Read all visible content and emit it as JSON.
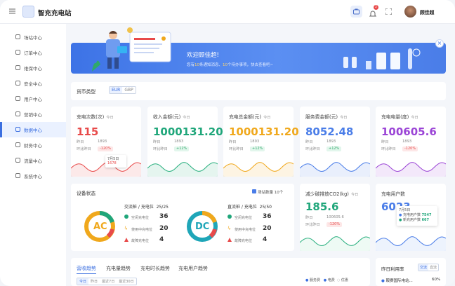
{
  "app": {
    "title": "智充充电站"
  },
  "user": {
    "name": "顾佳超",
    "notif_count": "2"
  },
  "sidebar": {
    "items": [
      {
        "label": "场站中心"
      },
      {
        "label": "订单中心"
      },
      {
        "label": "维保中心"
      },
      {
        "label": "安全中心"
      },
      {
        "label": "用户中心"
      },
      {
        "label": "营销中心"
      },
      {
        "label": "数据中心"
      },
      {
        "label": "财务中心"
      },
      {
        "label": "流量中心"
      },
      {
        "label": "系统中心"
      }
    ],
    "active_index": 6
  },
  "banner": {
    "title": "欢迎顾佳超!",
    "subtitle_pre": "您有",
    "n1": "10",
    "subtitle_mid": "条通知消息、",
    "n2": "10",
    "subtitle_post": "个待办事项，快去查看吧~"
  },
  "currency": {
    "label": "货币类型",
    "options": [
      "EUR",
      "GBP"
    ],
    "selected": "EUR"
  },
  "kpis": [
    {
      "title": "充电次数(次)",
      "sub": "今日",
      "value": "115",
      "color": "#e84a4a",
      "y_label": "昨日",
      "y_val": "1893",
      "r_label": "环比昨日",
      "r_val": "-120%",
      "r_kind": "red",
      "line": "#e84a4a",
      "tooltip_date": "7月5日",
      "tooltip_val": "1678"
    },
    {
      "title": "收入金额(元)",
      "sub": "今日",
      "value": "1000131.20",
      "color": "#1fa67a",
      "y_label": "昨日",
      "y_val": "1893",
      "r_label": "环比昨日",
      "r_val": "+12%",
      "r_kind": "green",
      "line": "#2ab07f"
    },
    {
      "title": "充电总金额(元)",
      "sub": "今日",
      "value": "1000131.20",
      "color": "#f0a81c",
      "y_label": "昨日",
      "y_val": "1893",
      "r_label": "环比昨日",
      "r_val": "+12%",
      "r_kind": "green",
      "line": "#f0a81c"
    },
    {
      "title": "服务费金额(元)",
      "sub": "今日",
      "value": "8052.48",
      "color": "#4a7de8",
      "y_label": "昨日",
      "y_val": "1893",
      "r_label": "环比昨日",
      "r_val": "+12%",
      "r_kind": "green",
      "line": "#4a7de8"
    },
    {
      "title": "充电电量(度)",
      "sub": "今日",
      "value": "100605.6",
      "color": "#9b45d6",
      "y_label": "昨日",
      "y_val": "1893",
      "r_label": "环比昨日",
      "r_val": "-120%",
      "r_kind": "red",
      "line": "#9b45d6"
    }
  ],
  "device": {
    "title": "设备状态",
    "site_label": "场站数量",
    "site_count": "10个",
    "ac": {
      "label": "AC",
      "header": "交流桩 / 充电位",
      "ratio": "25/25",
      "color": "#f0a81c",
      "rows": [
        {
          "label": "空闲充电位",
          "num": "36"
        },
        {
          "label": "使用中充电位",
          "num": "20"
        },
        {
          "label": "故障充电位",
          "num": "4"
        }
      ]
    },
    "dc": {
      "label": "DC",
      "header": "直流桩 / 充电位",
      "ratio": "25/50",
      "color": "#1fa6b8",
      "rows": [
        {
          "label": "空闲充电位",
          "num": "36"
        },
        {
          "label": "使用中充电位",
          "num": "20"
        },
        {
          "label": "故障充电位",
          "num": "4"
        }
      ]
    }
  },
  "co2": {
    "title": "减少碳排放CO2(kg)",
    "sub": "今日",
    "value": "185.6",
    "y_label": "昨日",
    "y_val": "100605.6",
    "r_label": "环比昨日",
    "r_val": "-120%"
  },
  "users": {
    "title": "充电用户数",
    "value": "6023",
    "tooltip_date": "7月5日",
    "t1_label": "充电用户数",
    "t1_val": "7547",
    "t2_label": "新充用户数",
    "t2_val": "667"
  },
  "bottom": {
    "tabs": [
      "营收趋势",
      "充电量趋势",
      "充电时长趋势",
      "充电用户趋势"
    ],
    "sub_tabs": [
      "今日",
      "昨日",
      "最近7日",
      "最近30日"
    ],
    "legend": [
      "服务费",
      "电费",
      "优惠"
    ],
    "util_title": "昨日利用率",
    "util_toggle": [
      "交流",
      "直流"
    ],
    "util_item": "鞍赛国际电站...",
    "util_val": "60%"
  }
}
